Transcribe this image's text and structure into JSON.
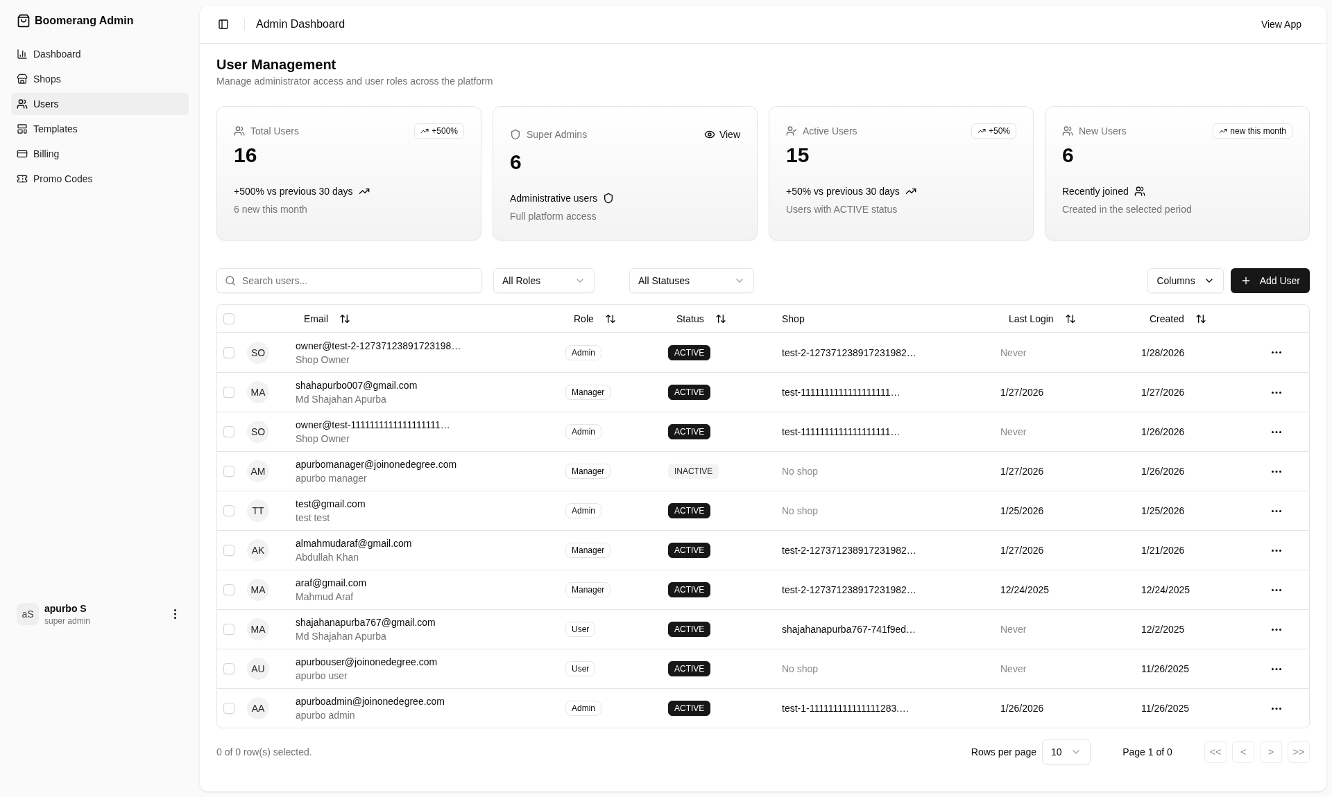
{
  "sidebar": {
    "brand": "Boomerang Admin",
    "items": [
      {
        "label": "Dashboard",
        "selected": false
      },
      {
        "label": "Shops",
        "selected": false
      },
      {
        "label": "Users",
        "selected": true
      },
      {
        "label": "Templates",
        "selected": false
      },
      {
        "label": "Billing",
        "selected": false
      },
      {
        "label": "Promo Codes",
        "selected": false
      }
    ],
    "user": {
      "initials": "aS",
      "name": "apurbo S",
      "role": "super admin"
    }
  },
  "header": {
    "title": "Admin Dashboard",
    "action": "View App"
  },
  "page": {
    "title": "User Management",
    "description": "Manage administrator access and user roles across the platform"
  },
  "stats": [
    {
      "label": "Total Users",
      "value": "16",
      "badge": "+500%",
      "summary": "+500% vs previous 30 days",
      "note": "6 new this month"
    },
    {
      "label": "Super Admins",
      "value": "6",
      "action": "View",
      "summary": "Administrative users",
      "note": "Full platform access"
    },
    {
      "label": "Active Users",
      "value": "15",
      "badge": "+50%",
      "summary": "+50% vs previous 30 days",
      "note": "Users with ACTIVE status"
    },
    {
      "label": "New Users",
      "value": "6",
      "badge": "new this month",
      "summary": "Recently joined",
      "note": "Created in the selected period"
    }
  ],
  "toolbar": {
    "search": {
      "placeholder": "Search users..."
    },
    "filters": [
      "All Roles",
      "All Statuses"
    ],
    "columns_button": "Columns",
    "add_button": "Add User"
  },
  "table": {
    "all_selected": false,
    "columns": [
      {
        "label": "Email",
        "sortable": true
      },
      {
        "label": "Role",
        "sortable": true
      },
      {
        "label": "Status",
        "sortable": true
      },
      {
        "label": "Shop",
        "sortable": false
      },
      {
        "label": "Last Login",
        "sortable": true
      },
      {
        "label": "Created",
        "sortable": true
      }
    ],
    "rows": [
      {
        "selected": false,
        "initials": "SO",
        "email": "owner@test-2-12737123891723198…",
        "name": "Shop Owner",
        "role": "Admin",
        "status": {
          "label": "ACTIVE",
          "active": true
        },
        "shop": {
          "text": "test-2-127371238917231982…",
          "muted": false
        },
        "last_login": {
          "text": "Never",
          "muted": true
        },
        "created": "1/28/2026"
      },
      {
        "selected": false,
        "initials": "MA",
        "email": "shahapurbo007@gmail.com",
        "name": "Md Shajahan Apurba",
        "role": "Manager",
        "status": {
          "label": "ACTIVE",
          "active": true
        },
        "shop": {
          "text": "test-1111111111111111111…",
          "muted": false
        },
        "last_login": {
          "text": "1/27/2026",
          "muted": false
        },
        "created": "1/27/2026"
      },
      {
        "selected": false,
        "initials": "SO",
        "email": "owner@test-1111111111111111111…",
        "name": "Shop Owner",
        "role": "Admin",
        "status": {
          "label": "ACTIVE",
          "active": true
        },
        "shop": {
          "text": "test-1111111111111111111…",
          "muted": false
        },
        "last_login": {
          "text": "Never",
          "muted": true
        },
        "created": "1/26/2026"
      },
      {
        "selected": false,
        "initials": "AM",
        "email": "apurbomanager@joinonedegree.com",
        "name": "apurbo manager",
        "role": "Manager",
        "status": {
          "label": "INACTIVE",
          "active": false
        },
        "shop": {
          "text": "No shop",
          "muted": true
        },
        "last_login": {
          "text": "1/27/2026",
          "muted": false
        },
        "created": "1/26/2026"
      },
      {
        "selected": false,
        "initials": "TT",
        "email": "test@gmail.com",
        "name": "test test",
        "role": "Admin",
        "status": {
          "label": "ACTIVE",
          "active": true
        },
        "shop": {
          "text": "No shop",
          "muted": true
        },
        "last_login": {
          "text": "1/25/2026",
          "muted": false
        },
        "created": "1/25/2026"
      },
      {
        "selected": false,
        "initials": "AK",
        "email": "almahmudaraf@gmail.com",
        "name": "Abdullah Khan",
        "role": "Manager",
        "status": {
          "label": "ACTIVE",
          "active": true
        },
        "shop": {
          "text": "test-2-127371238917231982…",
          "muted": false
        },
        "last_login": {
          "text": "1/27/2026",
          "muted": false
        },
        "created": "1/21/2026"
      },
      {
        "selected": false,
        "initials": "MA",
        "email": "araf@gmail.com",
        "name": "Mahmud Araf",
        "role": "Manager",
        "status": {
          "label": "ACTIVE",
          "active": true
        },
        "shop": {
          "text": "test-2-127371238917231982…",
          "muted": false
        },
        "last_login": {
          "text": "12/24/2025",
          "muted": false
        },
        "created": "12/24/2025"
      },
      {
        "selected": false,
        "initials": "MA",
        "email": "shajahanapurba767@gmail.com",
        "name": "Md Shajahan Apurba",
        "role": "User",
        "status": {
          "label": "ACTIVE",
          "active": true
        },
        "shop": {
          "text": "shajahanapurba767-741f9ed…",
          "muted": false
        },
        "last_login": {
          "text": "Never",
          "muted": true
        },
        "created": "12/2/2025"
      },
      {
        "selected": false,
        "initials": "AU",
        "email": "apurbouser@joinonedegree.com",
        "name": "apurbo user",
        "role": "User",
        "status": {
          "label": "ACTIVE",
          "active": true
        },
        "shop": {
          "text": "No shop",
          "muted": true
        },
        "last_login": {
          "text": "Never",
          "muted": true
        },
        "created": "11/26/2025"
      },
      {
        "selected": false,
        "initials": "AA",
        "email": "apurboadmin@joinonedegree.com",
        "name": "apurbo admin",
        "role": "Admin",
        "status": {
          "label": "ACTIVE",
          "active": true
        },
        "shop": {
          "text": "test-1-111111111111111283.…",
          "muted": false
        },
        "last_login": {
          "text": "1/26/2026",
          "muted": false
        },
        "created": "11/26/2025"
      }
    ]
  },
  "footer": {
    "selection": "0 of 0 row(s) selected.",
    "rows_per_page_label": "Rows per page",
    "rows_per_page": "10",
    "page_info": "Page 1 of 0",
    "buttons": [
      {
        "label": "<<",
        "disabled": true
      },
      {
        "label": "<",
        "disabled": true
      },
      {
        "label": ">",
        "disabled": true
      },
      {
        "label": ">>",
        "disabled": true
      }
    ]
  }
}
